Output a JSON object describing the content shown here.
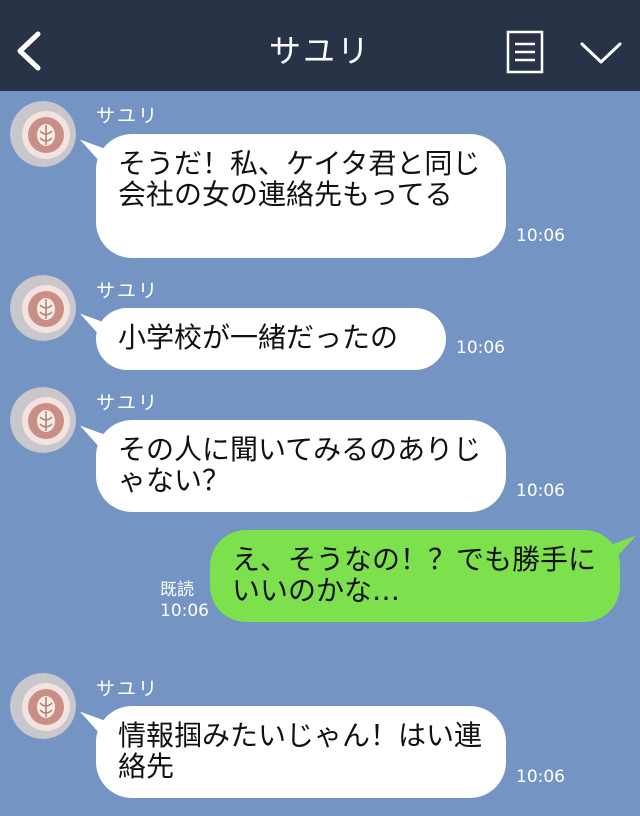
{
  "header": {
    "title": "サユリ",
    "back_icon": "chevron-left-icon",
    "memo_icon": "note-icon",
    "menu_icon": "chevron-down-icon",
    "background": "#283347"
  },
  "chat": {
    "background": "#7494c4",
    "messages": [
      {
        "side": "in",
        "sender": "サユリ",
        "text": "そうだ！私、ケイタ君と同じ会社の女の連絡先もってる",
        "time": "10:06"
      },
      {
        "side": "in",
        "sender": "サユリ",
        "text": "小学校が一緒だったの",
        "time": "10:06"
      },
      {
        "side": "in",
        "sender": "サユリ",
        "text": "その人に聞いてみるのありじゃない？",
        "time": "10:06"
      },
      {
        "side": "out",
        "read_label": "既読",
        "text": "え、そうなの！？でも勝手にいいのかな…",
        "time": "10:06"
      },
      {
        "side": "in",
        "sender": "サユリ",
        "text": "情報掴みたいじゃん！はい連絡先",
        "time": "10:06"
      }
    ]
  },
  "colors": {
    "outgoing_bubble": "#7de04d",
    "incoming_bubble": "#ffffff"
  }
}
